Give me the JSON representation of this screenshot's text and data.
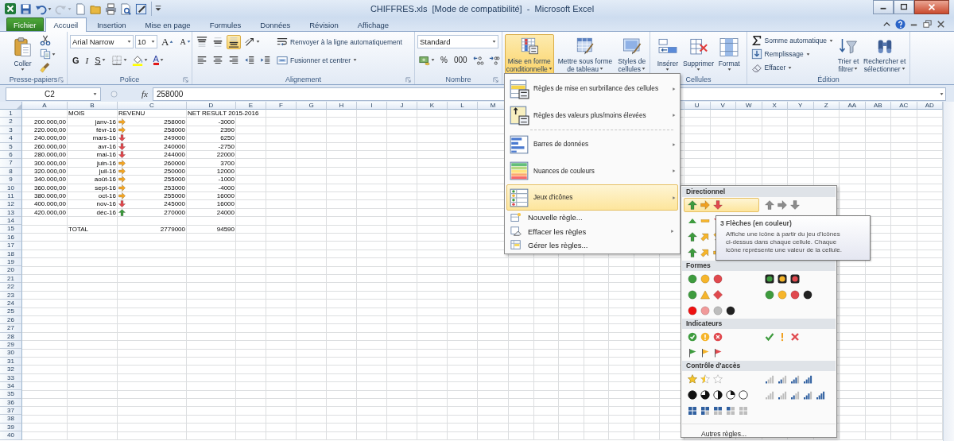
{
  "title_bar": {
    "title": "CHIFFRES.xls  [Mode de compatibilité]  -  Microsoft Excel",
    "quick_access": [
      {
        "kind": "logo",
        "disabled": false,
        "caret": false
      },
      {
        "kind": "button",
        "disabled": false,
        "caret": false
      },
      {
        "kind": "button",
        "disabled": false,
        "caret": true
      },
      {
        "kind": "button",
        "disabled": true,
        "caret": true
      },
      {
        "kind": "button",
        "disabled": false,
        "caret": false
      },
      {
        "kind": "button",
        "disabled": false,
        "caret": false
      },
      {
        "kind": "button",
        "disabled": false,
        "caret": false
      },
      {
        "kind": "button",
        "disabled": false,
        "caret": false
      },
      {
        "kind": "button",
        "disabled": false,
        "caret": false
      },
      {
        "kind": "customize",
        "disabled": false,
        "caret": false
      }
    ]
  },
  "ribbon_tabs": [
    {
      "kind": "file",
      "label": "Fichier",
      "selected": false
    },
    {
      "kind": "tab",
      "label": "Accueil",
      "selected": true
    },
    {
      "kind": "tab",
      "label": "Insertion",
      "selected": false
    },
    {
      "kind": "tab",
      "label": "Mise en page",
      "selected": false
    },
    {
      "kind": "tab",
      "label": "Formules",
      "selected": false
    },
    {
      "kind": "tab",
      "label": "Données",
      "selected": false
    },
    {
      "kind": "tab",
      "label": "Révision",
      "selected": false
    },
    {
      "kind": "tab",
      "label": "Affichage",
      "selected": false
    }
  ],
  "ribbon_groups": [
    {
      "label": "Presse-papiers",
      "launcher": true,
      "stacks": [
        {
          "tiers": [
            {
              "controls": [
                {
                  "kind": "large",
                  "lines": [
                    "Coller"
                  ],
                  "caret": true,
                  "pressed": false
                }
              ]
            }
          ]
        },
        {
          "tiers": [
            {
              "controls": [
                {
                  "kind": "icon",
                  "caret": false,
                  "pressed": false
                }
              ]
            },
            {
              "controls": [
                {
                  "kind": "icon",
                  "caret": true,
                  "pressed": false
                }
              ]
            },
            {
              "controls": [
                {
                  "kind": "icon",
                  "caret": false,
                  "pressed": false
                }
              ]
            }
          ]
        }
      ]
    },
    {
      "label": "Police",
      "launcher": true,
      "stacks": [
        {
          "tiers": [
            {
              "controls": [
                {
                  "kind": "font-field",
                  "value": "Arial Narrow"
                },
                {
                  "kind": "size-field",
                  "value": "10"
                },
                {
                  "kind": "grow",
                  "label": "A",
                  "caret": false,
                  "pressed": false
                },
                {
                  "kind": "shrink",
                  "label": "A",
                  "caret": false,
                  "pressed": false
                }
              ]
            },
            {
              "controls": [
                {
                  "kind": "bold",
                  "label": "G",
                  "caret": false,
                  "pressed": false
                },
                {
                  "kind": "italic",
                  "label": "I",
                  "caret": false,
                  "pressed": false
                },
                {
                  "kind": "underline",
                  "label": "S",
                  "caret": true,
                  "pressed": false
                },
                {
                  "kind": "icon",
                  "caret": true,
                  "pressed": false
                },
                {
                  "kind": "icon",
                  "caret": true,
                  "pressed": false
                },
                {
                  "kind": "font-color",
                  "label": "A",
                  "caret": true,
                  "pressed": false
                }
              ]
            }
          ]
        }
      ]
    },
    {
      "label": "Alignement",
      "launcher": true,
      "stacks": [
        {
          "tiers": [
            {
              "controls": [
                {
                  "kind": "icon",
                  "caret": false,
                  "pressed": false
                },
                {
                  "kind": "icon",
                  "caret": false,
                  "pressed": false
                },
                {
                  "kind": "icon",
                  "caret": false,
                  "pressed": true
                },
                {
                  "kind": "icon",
                  "caret": true,
                  "pressed": false
                }
              ]
            },
            {
              "controls": [
                {
                  "kind": "icon",
                  "caret": false,
                  "pressed": false
                },
                {
                  "kind": "icon",
                  "caret": false,
                  "pressed": false
                },
                {
                  "kind": "icon",
                  "caret": false,
                  "pressed": false
                },
                {
                  "kind": "icon",
                  "caret": false,
                  "pressed": false
                },
                {
                  "kind": "icon",
                  "caret": false,
                  "pressed": false
                }
              ]
            }
          ]
        },
        {
          "tiers": [
            {
              "controls": [
                {
                  "kind": "small",
                  "label": "Renvoyer à la ligne automatiquement",
                  "caret": false,
                  "pressed": false
                }
              ]
            },
            {
              "controls": [
                {
                  "kind": "small",
                  "label": "Fusionner et centrer",
                  "caret": true,
                  "pressed": false
                }
              ]
            }
          ]
        }
      ]
    },
    {
      "label": "Nombre",
      "launcher": true,
      "stacks": [
        {
          "tiers": [
            {
              "controls": [
                {
                  "kind": "format-field",
                  "value": "Standard"
                }
              ]
            },
            {
              "controls": [
                {
                  "kind": "icon",
                  "caret": true,
                  "pressed": false
                },
                {
                  "kind": "text",
                  "label": "%",
                  "caret": false,
                  "pressed": false
                },
                {
                  "kind": "text",
                  "label": "000",
                  "caret": false,
                  "pressed": false
                },
                {
                  "kind": "icon",
                  "caret": false,
                  "pressed": false
                },
                {
                  "kind": "icon",
                  "caret": false,
                  "pressed": false
                }
              ]
            }
          ]
        }
      ]
    },
    {
      "launcher": false,
      "stacks": [
        {
          "tiers": [
            {
              "controls": [
                {
                  "kind": "large",
                  "lines": [
                    "Mise en forme",
                    "conditionnelle"
                  ],
                  "caret": true,
                  "pressed": true
                }
              ]
            }
          ]
        },
        {
          "tiers": [
            {
              "controls": [
                {
                  "kind": "large",
                  "lines": [
                    "Mettre sous forme",
                    "de tableau"
                  ],
                  "caret": true,
                  "pressed": false
                }
              ]
            }
          ]
        },
        {
          "tiers": [
            {
              "controls": [
                {
                  "kind": "large",
                  "lines": [
                    "Styles de",
                    "cellules"
                  ],
                  "caret": true,
                  "pressed": false
                }
              ]
            }
          ]
        }
      ]
    },
    {
      "label": "Cellules",
      "launcher": false,
      "stacks": [
        {
          "tiers": [
            {
              "controls": [
                {
                  "kind": "large",
                  "lines": [
                    "Insérer"
                  ],
                  "caret": true,
                  "pressed": false
                }
              ]
            }
          ]
        },
        {
          "tiers": [
            {
              "controls": [
                {
                  "kind": "large",
                  "lines": [
                    "Supprimer"
                  ],
                  "caret": true,
                  "pressed": false
                }
              ]
            }
          ]
        },
        {
          "tiers": [
            {
              "controls": [
                {
                  "kind": "large",
                  "lines": [
                    "Format"
                  ],
                  "caret": true,
                  "pressed": false
                }
              ]
            }
          ]
        }
      ]
    },
    {
      "label": "Édition",
      "launcher": false,
      "stacks": [
        {
          "tiers": [
            {
              "controls": [
                {
                  "kind": "small",
                  "label": "Somme automatique",
                  "caret": true,
                  "pressed": false
                }
              ]
            },
            {
              "controls": [
                {
                  "kind": "small",
                  "label": "Remplissage",
                  "caret": true,
                  "pressed": false
                }
              ]
            },
            {
              "controls": [
                {
                  "kind": "small",
                  "label": "Effacer",
                  "caret": true,
                  "pressed": false
                }
              ]
            }
          ]
        },
        {
          "tiers": [
            {
              "controls": [
                {
                  "kind": "large",
                  "lines": [
                    "Trier et",
                    "filtrer"
                  ],
                  "caret": true,
                  "pressed": false
                }
              ]
            }
          ]
        },
        {
          "tiers": [
            {
              "controls": [
                {
                  "kind": "large",
                  "lines": [
                    "Rechercher et",
                    "sélectionner"
                  ],
                  "caret": true,
                  "pressed": false
                }
              ]
            }
          ]
        }
      ]
    }
  ],
  "formula_bar": {
    "name_box": "C2",
    "function_label": "fx",
    "value": "258000"
  },
  "sheet": {
    "columns": [
      "A",
      "B",
      "C",
      "D",
      "E",
      "F",
      "G",
      "H",
      "I",
      "J",
      "K",
      "L",
      "M",
      "U",
      "V",
      "W",
      "X",
      "Y",
      "Z",
      "AA",
      "AB",
      "AC",
      "AD"
    ],
    "rows": [
      {
        "number": "1",
        "kind": "header",
        "col_b": "MOIS",
        "col_c": "REVENU",
        "col_d": "NET RESULT 2015-2016"
      },
      {
        "number": "2",
        "kind": "data",
        "col_a": "200.000,00",
        "col_b": "janv-16",
        "trend": {
          "kind": "right"
        },
        "col_c": "258000",
        "col_d": "-3000"
      },
      {
        "number": "3",
        "kind": "data",
        "col_a": "220.000,00",
        "col_b": "févr-16",
        "trend": {
          "kind": "right"
        },
        "col_c": "258000",
        "col_d": "2390"
      },
      {
        "number": "4",
        "kind": "data",
        "col_a": "240.000,00",
        "col_b": "mars-16",
        "trend": {
          "kind": "down"
        },
        "col_c": "249000",
        "col_d": "6250"
      },
      {
        "number": "5",
        "kind": "data",
        "col_a": "260.000,00",
        "col_b": "avr-16",
        "trend": {
          "kind": "down"
        },
        "col_c": "240000",
        "col_d": "-2750"
      },
      {
        "number": "6",
        "kind": "data",
        "col_a": "280.000,00",
        "col_b": "mai-16",
        "trend": {
          "kind": "down"
        },
        "col_c": "244000",
        "col_d": "22000"
      },
      {
        "number": "7",
        "kind": "data",
        "col_a": "300.000,00",
        "col_b": "juin-16",
        "trend": {
          "kind": "right"
        },
        "col_c": "260000",
        "col_d": "3700"
      },
      {
        "number": "8",
        "kind": "data",
        "col_a": "320.000,00",
        "col_b": "juil-16",
        "trend": {
          "kind": "right"
        },
        "col_c": "250000",
        "col_d": "12000"
      },
      {
        "number": "9",
        "kind": "data",
        "col_a": "340.000,00",
        "col_b": "août-16",
        "trend": {
          "kind": "right"
        },
        "col_c": "255000",
        "col_d": "-1000"
      },
      {
        "number": "10",
        "kind": "data",
        "col_a": "360.000,00",
        "col_b": "sept-16",
        "trend": {
          "kind": "right"
        },
        "col_c": "253000",
        "col_d": "-4000"
      },
      {
        "number": "11",
        "kind": "data",
        "col_a": "380.000,00",
        "col_b": "oct-16",
        "trend": {
          "kind": "right"
        },
        "col_c": "255000",
        "col_d": "16000"
      },
      {
        "number": "12",
        "kind": "data",
        "col_a": "400.000,00",
        "col_b": "nov-16",
        "trend": {
          "kind": "down"
        },
        "col_c": "245000",
        "col_d": "16000"
      },
      {
        "number": "13",
        "kind": "data",
        "col_a": "420.000,00",
        "col_b": "déc-16",
        "trend": {
          "kind": "up"
        },
        "col_c": "270000",
        "col_d": "24000"
      },
      {
        "number": "14",
        "kind": "empty"
      },
      {
        "number": "15",
        "kind": "total",
        "col_b": "TOTAL",
        "col_c": "2779000",
        "col_d": "94590"
      },
      {
        "number": "16",
        "kind": "empty"
      },
      {
        "number": "17",
        "kind": "empty"
      },
      {
        "number": "18",
        "kind": "empty"
      },
      {
        "number": "19",
        "kind": "empty"
      },
      {
        "number": "20",
        "kind": "empty"
      },
      {
        "number": "21",
        "kind": "empty"
      },
      {
        "number": "22",
        "kind": "empty"
      },
      {
        "number": "23",
        "kind": "empty"
      },
      {
        "number": "24",
        "kind": "empty"
      },
      {
        "number": "25",
        "kind": "empty"
      },
      {
        "number": "26",
        "kind": "empty"
      },
      {
        "number": "27",
        "kind": "empty"
      },
      {
        "number": "28",
        "kind": "empty"
      },
      {
        "number": "29",
        "kind": "empty"
      },
      {
        "number": "30",
        "kind": "empty"
      },
      {
        "number": "31",
        "kind": "empty"
      },
      {
        "number": "32",
        "kind": "empty"
      },
      {
        "number": "33",
        "kind": "empty"
      },
      {
        "number": "34",
        "kind": "empty"
      },
      {
        "number": "35",
        "kind": "empty"
      },
      {
        "number": "36",
        "kind": "empty"
      },
      {
        "number": "37",
        "kind": "empty"
      },
      {
        "number": "38",
        "kind": "empty"
      },
      {
        "number": "39",
        "kind": "empty"
      },
      {
        "number": "40",
        "kind": "empty"
      }
    ]
  },
  "conditional_format_menu": {
    "items": [
      {
        "kind": "large",
        "label": "Règles de mise en surbrillance des cellules",
        "submenu": true,
        "selected": false
      },
      {
        "kind": "large",
        "label": "Règles des valeurs plus/moins élevées",
        "submenu": true,
        "selected": false
      },
      {
        "kind": "separator"
      },
      {
        "kind": "large",
        "label": "Barres de données",
        "submenu": true,
        "selected": false
      },
      {
        "kind": "large",
        "label": "Nuances de couleurs",
        "submenu": true,
        "selected": false
      },
      {
        "kind": "large",
        "label": "Jeux d'icônes",
        "submenu": true,
        "selected": true
      },
      {
        "kind": "small",
        "label": "Nouvelle règle...",
        "submenu": false,
        "selected": false
      },
      {
        "kind": "small",
        "label": "Effacer les règles",
        "submenu": true,
        "selected": false
      },
      {
        "kind": "small",
        "label": "Gérer les règles...",
        "submenu": false,
        "selected": false
      }
    ]
  },
  "icon_sets_menu": {
    "sections": [
      {
        "title": "Directionnel",
        "lines": [
          {
            "options": [
              {
                "kind": "arrows-3-color",
                "selected": true
              },
              {
                "kind": "arrows-3-gray",
                "selected": false
              }
            ]
          },
          {
            "options": [
              {
                "kind": "triangles-3",
                "selected": false
              }
            ]
          },
          {
            "options": [
              {
                "kind": "arrows-4-color",
                "selected": false
              }
            ]
          },
          {
            "options": [
              {
                "kind": "arrows-5-color",
                "selected": false
              }
            ]
          }
        ]
      },
      {
        "title": "Formes",
        "lines": [
          {
            "options": [
              {
                "kind": "circles-3",
                "selected": false
              },
              {
                "kind": "traffic-lights-3",
                "selected": false
              }
            ]
          },
          {
            "options": [
              {
                "kind": "signs-3",
                "selected": false
              },
              {
                "kind": "circles-4",
                "selected": false
              }
            ]
          },
          {
            "options": [
              {
                "kind": "red-black-4",
                "selected": false
              }
            ]
          }
        ]
      },
      {
        "title": "Indicateurs",
        "lines": [
          {
            "options": [
              {
                "kind": "symbols-circled-3",
                "selected": false
              },
              {
                "kind": "symbols-3",
                "selected": false
              }
            ]
          },
          {
            "options": [
              {
                "kind": "flags-3",
                "selected": false
              }
            ]
          }
        ]
      },
      {
        "title": "Contrôle d'accès",
        "lines": [
          {
            "options": [
              {
                "kind": "stars-3",
                "selected": false
              },
              {
                "kind": "bars-4",
                "selected": false
              }
            ]
          },
          {
            "options": [
              {
                "kind": "quarters-5",
                "selected": false
              },
              {
                "kind": "bars-5",
                "selected": false
              }
            ]
          },
          {
            "options": [
              {
                "kind": "boxes-5",
                "selected": false
              }
            ]
          }
        ]
      }
    ],
    "footer": "Autres règles..."
  },
  "tooltip": {
    "title": "3 Flèches (en couleur)",
    "text": "Affiche une icône à partir du jeu d'icônes ci-dessus dans chaque cellule. Chaque icône représente une valeur de la cellule."
  }
}
